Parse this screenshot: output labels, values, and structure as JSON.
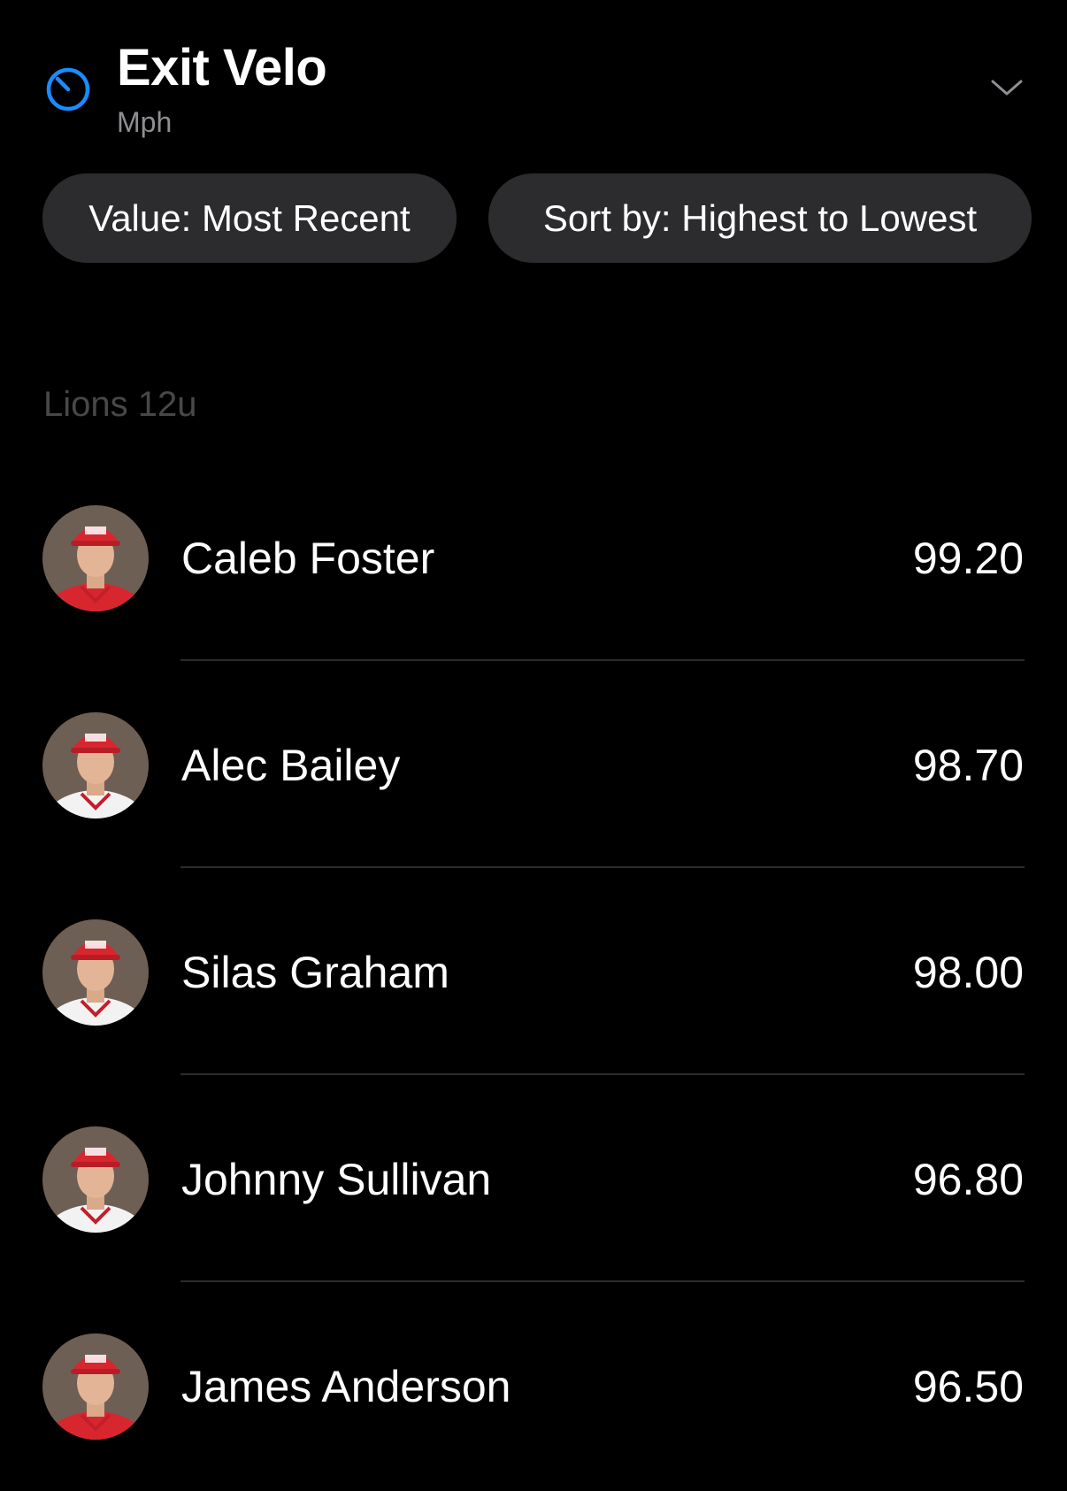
{
  "metric": {
    "title": "Exit Velo",
    "unit": "Mph",
    "icon": "stopwatch-icon",
    "accent_color": "#1a8cff"
  },
  "filters": {
    "value_label": "Value: Most Recent",
    "sort_label": "Sort by: Highest to Lowest"
  },
  "team": {
    "name": "Lions 12u"
  },
  "players": [
    {
      "name": "Caleb Foster",
      "value": "99.20",
      "jersey_color": "#d8262f"
    },
    {
      "name": "Alec Bailey",
      "value": "98.70",
      "jersey_color": "#f2f2f2"
    },
    {
      "name": "Silas Graham",
      "value": "98.00",
      "jersey_color": "#f2f2f2"
    },
    {
      "name": "Johnny Sullivan",
      "value": "96.80",
      "jersey_color": "#f2f2f2"
    },
    {
      "name": "James Anderson",
      "value": "96.50",
      "jersey_color": "#d8262f"
    }
  ]
}
